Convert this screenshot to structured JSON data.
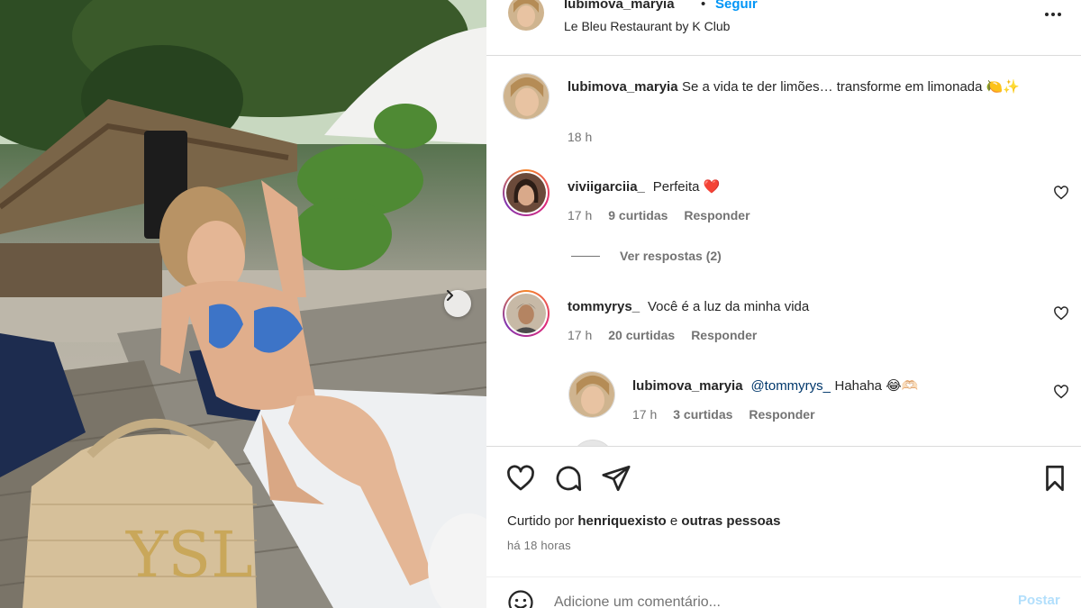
{
  "header": {
    "username": "lubimova_maryia",
    "separator": "•",
    "follow_label": "Seguir",
    "location": "Le Bleu Restaurant by K Club",
    "more_icon": "more-horizontal-icon"
  },
  "caption": {
    "username": "lubimova_maryia",
    "text": "Se a vida te der limões… transforme em limonada 🍋✨",
    "time": "18 h"
  },
  "comments": [
    {
      "username": "viviigarciia_",
      "text": "Perfeita ❤️",
      "time": "17 h",
      "likes": "9 curtidas",
      "reply_label": "Responder",
      "view_replies": "Ver respostas (2)"
    },
    {
      "username": "tommyrys_",
      "text": "Você é a luz da minha vida",
      "time": "17 h",
      "likes": "20 curtidas",
      "reply_label": "Responder"
    }
  ],
  "reply": {
    "username": "lubimova_maryia",
    "mention": "@tommyrys_",
    "text": "Hahaha 😂🫶🏻",
    "time": "17 h",
    "likes": "3 curtidas",
    "reply_label": "Responder"
  },
  "actions": {
    "like_icon": "heart-icon",
    "comment_icon": "comment-icon",
    "share_icon": "send-icon",
    "save_icon": "bookmark-icon",
    "liked_prefix": "Curtido por",
    "liked_user": "henriquexisto",
    "liked_connector": "e",
    "liked_others": "outras pessoas",
    "time_ago": "há 18 horas"
  },
  "composer": {
    "emoji_icon": "emoji-icon",
    "placeholder": "Adicione um comentário...",
    "post_label": "Postar"
  },
  "colors": {
    "accent": "#0095f6",
    "post_disabled": "#b2dffc",
    "muted": "#737373",
    "text": "#262626",
    "border": "#dbdbdb"
  }
}
